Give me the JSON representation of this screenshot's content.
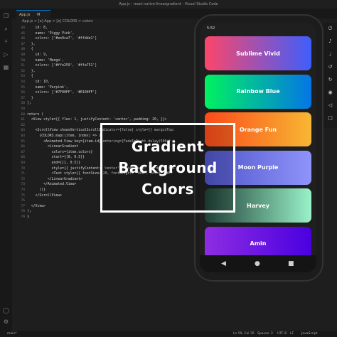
{
  "window": {
    "title": "App.js - react-native-lineargradient - Visual Studio Code"
  },
  "editor": {
    "tab_label": "App.js",
    "tab_status": "M",
    "breadcrumb": "App.js  >  [e] App  >  [e] COLORS  >  colors",
    "lines": [
      {
        "n": "44",
        "t": "    id: 8,"
      },
      {
        "n": "45",
        "t": "    name: 'Piggy Pink',"
      },
      {
        "n": "46",
        "t": "    colors: ['#ee9ca7', '#ffdde1']"
      },
      {
        "n": "47",
        "t": "  },"
      },
      {
        "n": "48",
        "t": "  {"
      },
      {
        "n": "49",
        "t": "    id: 9,"
      },
      {
        "n": "50",
        "t": "    name: 'Mango',"
      },
      {
        "n": "51",
        "t": "    colors: ['#ffe259', '#ffa751']"
      },
      {
        "n": "52",
        "t": "  },"
      },
      {
        "n": "53",
        "t": "  {"
      },
      {
        "n": "54",
        "t": "    id: 10,"
      },
      {
        "n": "55",
        "t": "    name: 'Purpink',"
      },
      {
        "n": "56",
        "t": "    colors: ['#7F00FF', '#E100FF']"
      },
      {
        "n": "57",
        "t": "  }"
      },
      {
        "n": "58",
        "t": "];"
      },
      {
        "n": "59",
        "t": ""
      },
      {
        "n": "60",
        "t": "return ("
      },
      {
        "n": "61",
        "t": "  <View style={{ flex: 1, justifyContent: 'center', padding: 20, }}>"
      },
      {
        "n": "62",
        "t": ""
      },
      {
        "n": "63",
        "t": "    <ScrollView showsVerticalScrollIndicator={false} style={{ marginTop:"
      },
      {
        "n": "64",
        "t": "      {COLORS.map((item, index) => ("
      },
      {
        "n": "65",
        "t": "        <Animated.View key={item.id} entering={FadeInRight.delay(500 * ("
      },
      {
        "n": "66",
        "t": "          <LinearGradient"
      },
      {
        "n": "67",
        "t": "            colors={item.colors}"
      },
      {
        "n": "68",
        "t": "            start={[0, 0.5]}"
      },
      {
        "n": "69",
        "t": "            end={[1, 0.5]}"
      },
      {
        "n": "70",
        "t": "            style={{ justifyContent: 'center', alignItems: 'center', hei"
      },
      {
        "n": "71",
        "t": "            <Text style={{ fontSize: 20, fontWeight: '800', color: '#FF"
      },
      {
        "n": "72",
        "t": "          </LinearGradient>"
      },
      {
        "n": "73",
        "t": "        </Animated.View>"
      },
      {
        "n": "74",
        "t": "      ))}"
      },
      {
        "n": "75",
        "t": "    </ScrollView>"
      },
      {
        "n": "76",
        "t": ""
      },
      {
        "n": "77",
        "t": "  </View>"
      },
      {
        "n": "78",
        "t": ");"
      },
      {
        "n": "79",
        "t": "}"
      }
    ]
  },
  "phone": {
    "time": "5:52",
    "cards": [
      {
        "label": "Sublime Vivid",
        "from": "#FC466B",
        "to": "#3F5EFB"
      },
      {
        "label": "Rainbow Blue",
        "from": "#00F260",
        "to": "#0575E6"
      },
      {
        "label": "Orange Fun",
        "from": "#fc4a1a",
        "to": "#f7b733"
      },
      {
        "label": "Moon Purple",
        "from": "#4e54c8",
        "to": "#8f94fb"
      },
      {
        "label": "Harvey",
        "from": "#1f4037",
        "to": "#99f2c8"
      },
      {
        "label": "Amin",
        "from": "#8E2DE2",
        "to": "#4A00E0"
      }
    ]
  },
  "overlay": {
    "lines": [
      "Gradient",
      "Background",
      "Colors"
    ]
  },
  "statusbar": {
    "branch": "main*",
    "position": "Ln 59, Col 35",
    "spaces": "Spaces: 2",
    "encoding": "UTF-8",
    "eol": "LF",
    "language": "JavaScript"
  },
  "colors": {
    "accent": "#0078d4",
    "editor_bg": "#1e1e1e"
  }
}
